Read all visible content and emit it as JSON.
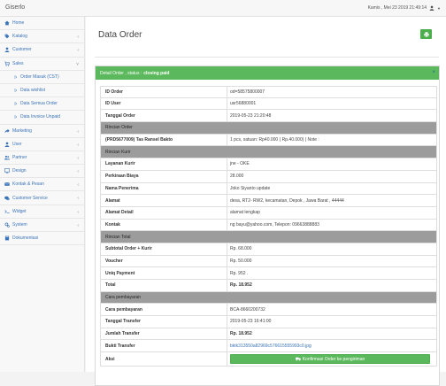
{
  "app": {
    "brand": "Giserlo"
  },
  "topbar": {
    "datetime": "Kamis , Mei 23 2019 21:49:14"
  },
  "sidebar": {
    "items": [
      {
        "label": "Home",
        "icon": "home-icon",
        "chevron": ""
      },
      {
        "label": "Katalog",
        "icon": "tags-icon",
        "chevron": "‹"
      },
      {
        "label": "Customer",
        "icon": "user-icon",
        "chevron": "‹"
      },
      {
        "label": "Sales",
        "icon": "cart-icon",
        "chevron": "˅"
      },
      {
        "label": "Order Masuk (CST)",
        "icon": "angle-icon",
        "chevron": "",
        "sub": true
      },
      {
        "label": "Data wishlist",
        "icon": "angle-icon",
        "chevron": "",
        "sub": true
      },
      {
        "label": "Data Semua Order",
        "icon": "angle-icon",
        "chevron": "",
        "sub": true
      },
      {
        "label": "Data Invoice Unpaid",
        "icon": "angle-icon",
        "chevron": "",
        "sub": true
      },
      {
        "label": "Marketing",
        "icon": "share-icon",
        "chevron": "‹"
      },
      {
        "label": "User",
        "icon": "user-icon",
        "chevron": "‹"
      },
      {
        "label": "Partner",
        "icon": "users-icon",
        "chevron": "‹"
      },
      {
        "label": "Design",
        "icon": "desktop-icon",
        "chevron": "‹"
      },
      {
        "label": "Kontak & Pesan",
        "icon": "envelope-icon",
        "chevron": "‹"
      },
      {
        "label": "Customer Service",
        "icon": "comments-icon",
        "chevron": "‹"
      },
      {
        "label": "Widget",
        "icon": "terminal-icon",
        "chevron": "‹"
      },
      {
        "label": "System",
        "icon": "gears-icon",
        "chevron": "‹"
      },
      {
        "label": "Dokumentasi",
        "icon": "book-icon",
        "chevron": ""
      }
    ]
  },
  "page": {
    "title": "Data Order"
  },
  "panel": {
    "head_text": "Detail Order , status :",
    "status": "closing paid",
    "collapse": "×"
  },
  "rows": [
    {
      "k": "ID Order",
      "v": "od=58575800007"
    },
    {
      "k": "ID User",
      "v": "usr56880001"
    },
    {
      "k": "Tanggal Order",
      "v": "2019-05-23 21:20:48"
    },
    {
      "k": "Rincian Order",
      "section": true
    },
    {
      "k": "(PRD5677009) Tas Ransel Bakto",
      "v": "1 pcs, satuan: Rp40.000 ( Rp.40.000) | Note :"
    },
    {
      "k": "Rincian Kurir",
      "section": true
    },
    {
      "k": "Layanan Kurir",
      "v": "jne - OKE"
    },
    {
      "k": "Perkiraan Biaya",
      "v": "28.000"
    },
    {
      "k": "Nama Penerima",
      "v": "Joko Siyanto update"
    },
    {
      "k": "Alamat",
      "v": "desa, RT2- RW2, kecamatan, Depok , Jawa Barat , 44444"
    },
    {
      "k": "Alamat Detail",
      "v": "alamat lengkap"
    },
    {
      "k": "Kontak",
      "v": "ng bayu@yahoo.com, Telepon: 09663888883"
    },
    {
      "k": "Rincian Total",
      "section": true
    },
    {
      "k": "Subtotal Order + Kurir",
      "v": "Rp. 68.000"
    },
    {
      "k": "Voucher",
      "v": "Rp. 50.000"
    },
    {
      "k": "Uniq Payment",
      "v": "Rp. 952 ."
    },
    {
      "k": "Total",
      "v": "Rp. 18.952",
      "bold": true
    },
    {
      "k": "Cara pembayaran",
      "section": true
    },
    {
      "k": "Cara pembayaran",
      "v": "BCA-8660200732"
    },
    {
      "k": "Tanggal Transfer",
      "v": "2019-05-23 16:41:00"
    },
    {
      "k": "Jumlah Transfer",
      "v": "Rp. 18.952",
      "bold": true
    },
    {
      "k": "Bukti Transfer",
      "v": "bktk313550a82969c576615555993c0.jpg",
      "link": true
    },
    {
      "k": "Aksi",
      "action": "Konfirmasi Order ke pengiriman"
    }
  ],
  "colors": {
    "success": "#5cb85c",
    "link": "#3a73b8",
    "section": "#9c9c9c"
  }
}
